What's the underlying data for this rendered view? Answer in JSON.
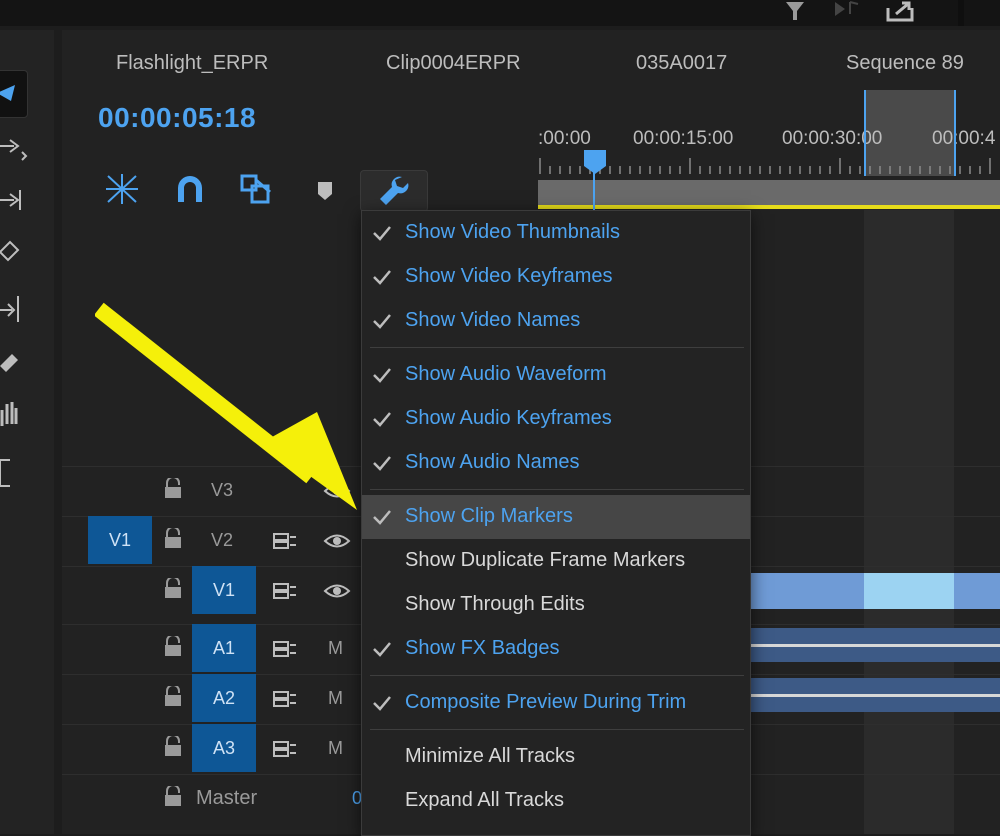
{
  "sequence_tabs": [
    "Flashlight_ERPR",
    "Clip0004ERPR",
    "035A0017",
    "Sequence 89"
  ],
  "timecode": "00:00:05:18",
  "ruler_labels": [
    ":00:00",
    "00:00:15:00",
    "00:00:30:00",
    "00:00:4"
  ],
  "tracks": {
    "v3": "V3",
    "v2": "V2",
    "v1": "V1",
    "source_v1": "V1",
    "a1": "A1",
    "a2": "A2",
    "a3": "A3",
    "mute": "M",
    "master": "Master",
    "master_value": "0"
  },
  "menu": {
    "items": [
      {
        "label": "Show Video Thumbnails",
        "checked": true
      },
      {
        "label": "Show Video Keyframes",
        "checked": true
      },
      {
        "label": "Show Video Names",
        "checked": true
      },
      {
        "label": "Show Audio Waveform",
        "checked": true
      },
      {
        "label": "Show Audio Keyframes",
        "checked": true
      },
      {
        "label": "Show Audio Names",
        "checked": true
      },
      {
        "label": "Show Clip Markers",
        "checked": true,
        "highlighted": true
      },
      {
        "label": "Show Duplicate Frame Markers",
        "checked": false
      },
      {
        "label": "Show Through Edits",
        "checked": false
      },
      {
        "label": "Show FX Badges",
        "checked": true
      },
      {
        "label": "Composite Preview During Trim",
        "checked": true
      },
      {
        "label": "Minimize All Tracks",
        "checked": false
      },
      {
        "label": "Expand All Tracks",
        "checked": false
      }
    ]
  },
  "colors": {
    "accent": "#4da3f0",
    "track_target": "#0e5796",
    "annotation_arrow": "#f5f00a",
    "clip_video": "#6f9bd6",
    "clip_audio": "#3d5a86"
  },
  "icons": [
    "snap-icon",
    "linked-selection-icon",
    "add-marker-icon",
    "wrench-icon",
    "lock-icon",
    "eye-icon",
    "sync-lock-icon",
    "filter-icon",
    "export-icon"
  ]
}
